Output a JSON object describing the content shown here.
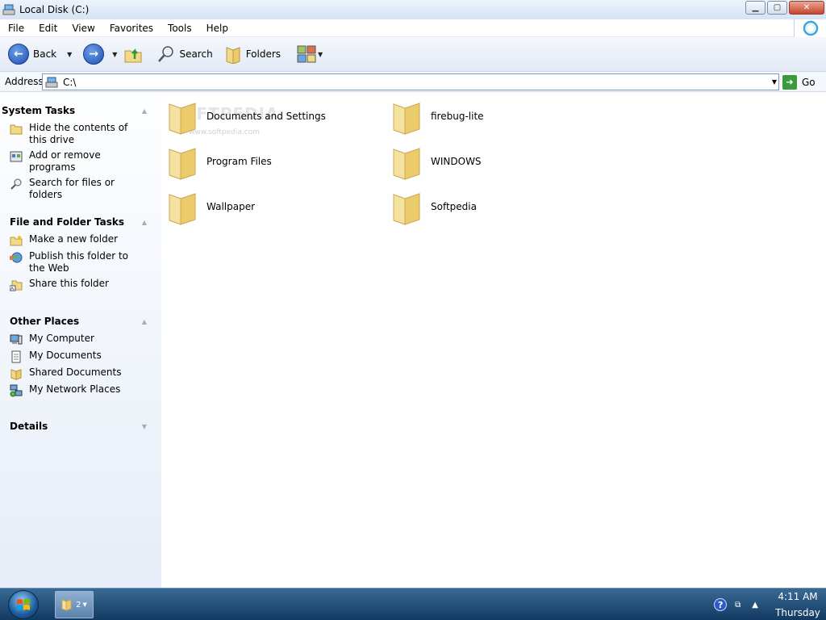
{
  "window": {
    "title": "Local Disk (C:)"
  },
  "menu": {
    "items": [
      "File",
      "Edit",
      "View",
      "Favorites",
      "Tools",
      "Help"
    ]
  },
  "toolbar": {
    "back_label": "Back",
    "search_label": "Search",
    "folders_label": "Folders"
  },
  "address": {
    "label": "Address",
    "value": "C:\\",
    "go_label": "Go"
  },
  "taskpane": {
    "system_tasks": {
      "title": "System Tasks",
      "items": [
        {
          "label": "Hide the contents of this drive",
          "icon": "folder-icon"
        },
        {
          "label": "Add or remove programs",
          "icon": "programs-icon"
        },
        {
          "label": "Search for files or folders",
          "icon": "search-icon"
        }
      ]
    },
    "file_folder_tasks": {
      "title": "File and Folder Tasks",
      "items": [
        {
          "label": "Make a new folder",
          "icon": "new-folder-icon"
        },
        {
          "label": "Publish this folder to the Web",
          "icon": "globe-icon"
        },
        {
          "label": "Share this folder",
          "icon": "share-icon"
        }
      ]
    },
    "other_places": {
      "title": "Other Places",
      "items": [
        {
          "label": "My Computer",
          "icon": "computer-icon"
        },
        {
          "label": "My Documents",
          "icon": "documents-icon"
        },
        {
          "label": "Shared Documents",
          "icon": "shared-folder-icon"
        },
        {
          "label": "My Network Places",
          "icon": "network-icon"
        }
      ]
    },
    "details": {
      "title": "Details"
    }
  },
  "content": {
    "watermark": "SOFTPEDIA",
    "watermark_sub": "www.softpedia.com",
    "folders": [
      "Documents and Settings",
      "firebug-lite",
      "Program Files",
      "WINDOWS",
      "Wallpaper",
      "Softpedia"
    ]
  },
  "taskbar": {
    "task_count": "2",
    "time": "4:11 AM",
    "day": "Thursday"
  },
  "colors": {
    "taskbar": "#1c4a78",
    "taskpane": "#e6edf8",
    "folder": "#f2d98a"
  }
}
